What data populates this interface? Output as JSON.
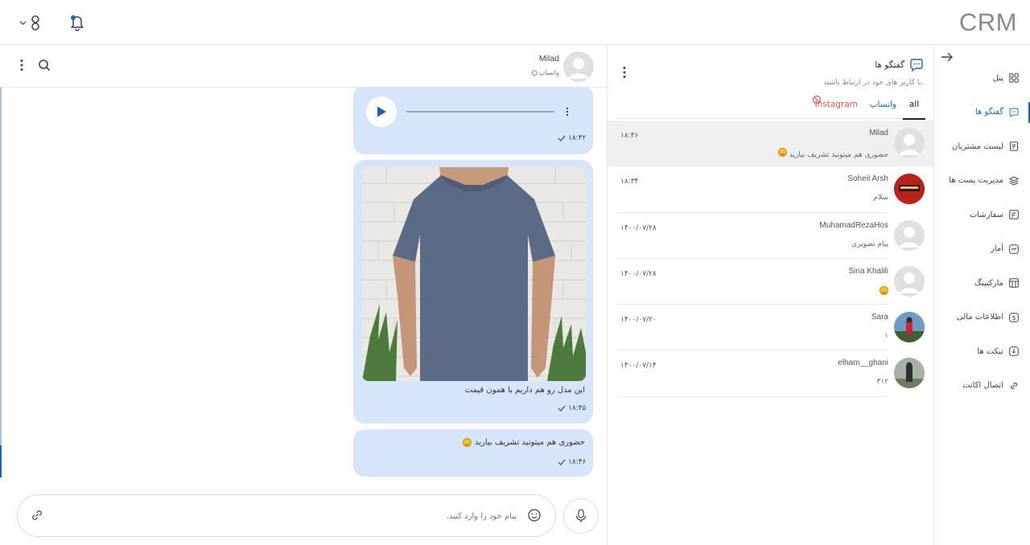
{
  "app": {
    "logo": "CRM"
  },
  "sidebar": {
    "items": [
      {
        "label": "پنل",
        "icon": "grid-icon"
      },
      {
        "label": "گفتگو ها",
        "icon": "chat-icon"
      },
      {
        "label": "لیست مشتریان",
        "icon": "list-icon"
      },
      {
        "label": "مدیریت پست ها",
        "icon": "layers-icon"
      },
      {
        "label": "سفارشات",
        "icon": "orders-icon"
      },
      {
        "label": "آمار",
        "icon": "stats-icon"
      },
      {
        "label": "مارکتینگ",
        "icon": "store-icon"
      },
      {
        "label": "اطلاعات مالی",
        "icon": "dollar-icon"
      },
      {
        "label": "تیکت ها",
        "icon": "ticket-icon"
      },
      {
        "label": "اتصال اکانت",
        "icon": "link-icon"
      }
    ],
    "active_index": 1
  },
  "conversations": {
    "title": "گفتگو ها",
    "subtitle": "با کاربر های خود در ارتباط باشید.",
    "tabs": {
      "all": "all",
      "whatsapp": "واتساپ",
      "instagram": "Instagram"
    },
    "items": [
      {
        "name": "Milad",
        "message": "حضوری هم میتونید تشریف بیارید",
        "time": "۱۸:۴۶",
        "emoji": true
      },
      {
        "name": "Soheil Arsh",
        "message": "سلام",
        "time": "۱۸:۳۴"
      },
      {
        "name": "MuhamadRezaHos",
        "message": "پیام تصویری",
        "time": "۱۴۰۰/۰۷/۲۸"
      },
      {
        "name": "Sina Khalili",
        "message": "",
        "time": "۱۴۰۰/۰۷/۲۸",
        "emoji": true
      },
      {
        "name": "Sara",
        "message": "۱",
        "time": "۱۴۰۰/۰۷/۲۰"
      },
      {
        "name": "elham__ghani",
        "message": "۳۱۲",
        "time": "۱۴۰۰/۰۷/۱۴"
      }
    ]
  },
  "chat": {
    "contact_name": "Milad",
    "contact_source": "واتساپ",
    "messages": {
      "audio_time": "۱۸:۴۲",
      "image_caption": "این مدل رو هم داریم با همون قیمت",
      "image_time": "۱۸:۴۵",
      "text": "حضوری هم میتونید تشریف بیارید",
      "text_time": "۱۸:۴۶"
    },
    "composer": {
      "placeholder": "پیام خود را وارد کنید."
    }
  },
  "colors": {
    "accent": "#1565c0",
    "bubble": "#d6e5fa",
    "instagram": "#e0564d"
  }
}
